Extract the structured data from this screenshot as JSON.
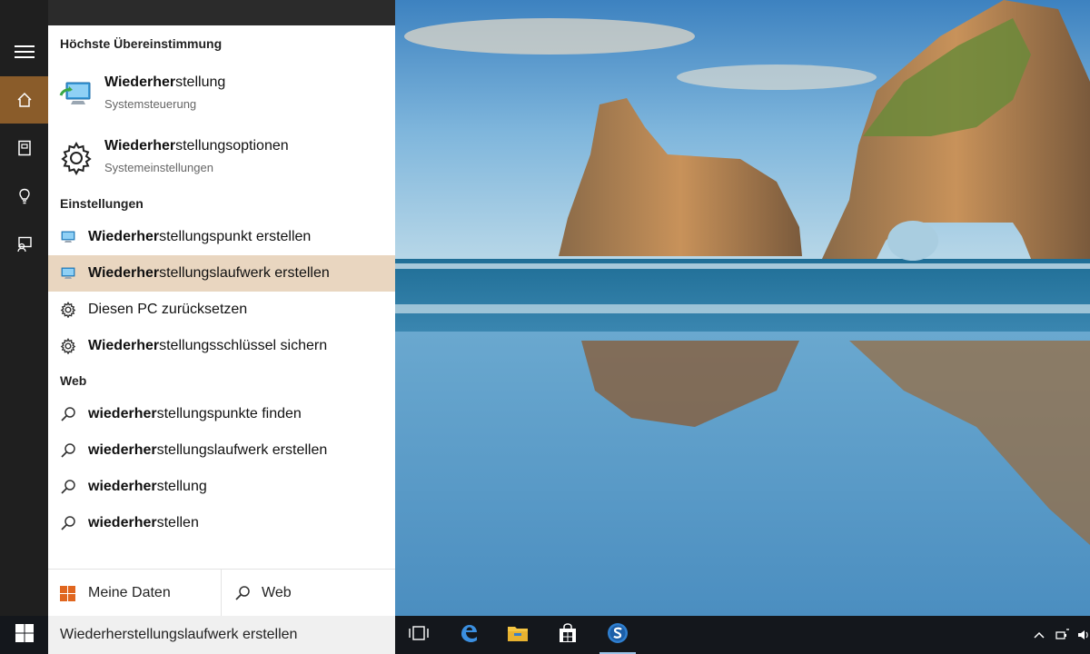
{
  "rail": {
    "items": [
      {
        "name": "menu-icon"
      },
      {
        "name": "home-icon"
      },
      {
        "name": "notebook-icon"
      },
      {
        "name": "lightbulb-icon"
      },
      {
        "name": "feedback-icon"
      }
    ]
  },
  "search_panel": {
    "best_match_header": "Höchste Übereinstimmung",
    "best_matches": [
      {
        "name_bold": "Wiederher",
        "name_rest": "stellung",
        "sub": "Systemsteuerung",
        "icon": "control-panel-icon"
      },
      {
        "name_bold": "Wiederher",
        "name_rest": "stellungsoptionen",
        "sub": "Systemeinstellungen",
        "icon": "gear-icon"
      }
    ],
    "settings_header": "Einstellungen",
    "settings": [
      {
        "bold": "Wiederher",
        "rest": "stellungspunkt erstellen",
        "icon": "monitor-icon",
        "selected": false
      },
      {
        "bold": "Wiederher",
        "rest": "stellungslaufwerk erstellen",
        "icon": "monitor-icon",
        "selected": true
      },
      {
        "bold": "",
        "rest": "Diesen PC zurücksetzen",
        "icon": "gear-icon",
        "selected": false
      },
      {
        "bold": "Wiederher",
        "rest": "stellungsschlüssel sichern",
        "icon": "gear-icon",
        "selected": false
      }
    ],
    "web_header": "Web",
    "web": [
      {
        "bold": "wiederher",
        "rest": "stellungspunkte finden"
      },
      {
        "bold": "wiederher",
        "rest": "stellungslaufwerk erstellen"
      },
      {
        "bold": "wiederher",
        "rest": "stellung"
      },
      {
        "bold": "wiederher",
        "rest": "stellen"
      }
    ],
    "tabs": {
      "my_data": "Meine Daten",
      "web": "Web"
    }
  },
  "taskbar": {
    "search_text": "Wiederherstellungslaufwerk erstellen",
    "icons": [
      "task-view-icon",
      "edge-icon",
      "file-explorer-icon",
      "store-icon",
      "app-icon"
    ],
    "accent": "#9cc4e8"
  },
  "colors": {
    "rail_active": "#8a5c2a",
    "selected_row": "#e9d6c0"
  }
}
